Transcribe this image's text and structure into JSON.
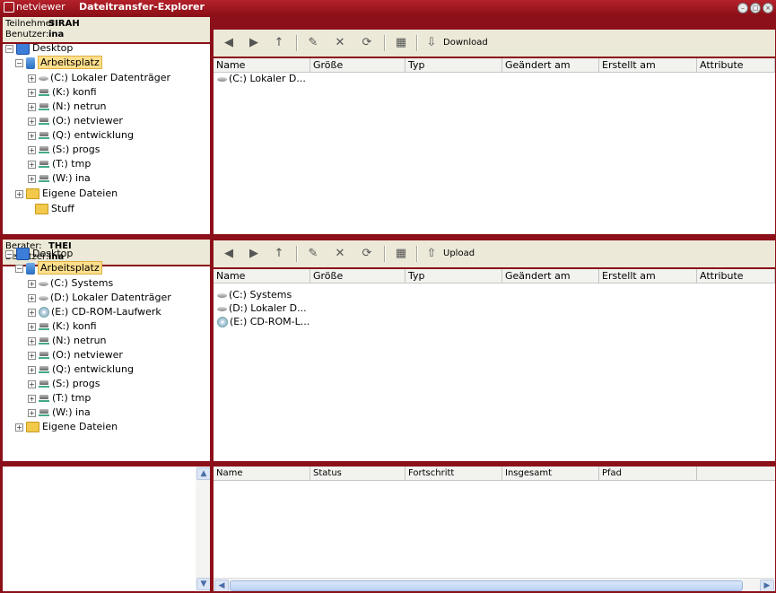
{
  "title_bar": {
    "app_name": "netviewer",
    "title": "Dateitransfer-Explorer"
  },
  "remote": {
    "info": {
      "label1": "Teilnehmer:",
      "value1": "SIRAH",
      "label2": "Benutzer:",
      "value2": "ina"
    },
    "toolbar": {
      "action_label": "Download"
    },
    "tree": {
      "root": "Desktop",
      "computer": "Arbeitsplatz",
      "drives": [
        "(C:) Lokaler Datenträger",
        "(K:) konfi",
        "(N:) netrun",
        "(O:) netviewer",
        "(Q:) entwicklung",
        "(S:) progs",
        "(T:) tmp",
        "(W:) ina"
      ],
      "my_files": "Eigene Dateien",
      "stuff": "Stuff"
    },
    "columns": [
      "Name",
      "Größe",
      "Typ",
      "Geändert am",
      "Erstellt am",
      "Attribute"
    ],
    "files": [
      "(C:) Lokaler D..."
    ]
  },
  "local": {
    "info": {
      "label1": "Berater:",
      "value1": "THEI",
      "label2": "Benutzer:",
      "value2": "ina"
    },
    "toolbar": {
      "action_label": "Upload"
    },
    "tree": {
      "root": "Desktop",
      "computer": "Arbeitsplatz",
      "drives": [
        "(C:) Systems",
        "(D:) Lokaler Datenträger",
        "(E:) CD-ROM-Laufwerk",
        "(K:) konfi",
        "(N:) netrun",
        "(O:) netviewer",
        "(Q:) entwicklung",
        "(S:) progs",
        "(T:) tmp",
        "(W:) ina"
      ],
      "my_files": "Eigene Dateien"
    },
    "columns": [
      "Name",
      "Größe",
      "Typ",
      "Geändert am",
      "Erstellt am",
      "Attribute"
    ],
    "files": [
      "(C:) Systems",
      "(D:) Lokaler D...",
      "(E:) CD-ROM-L..."
    ]
  },
  "transfers": {
    "columns": [
      "Name",
      "Status",
      "Fortschritt",
      "Insgesamt",
      "Pfad"
    ]
  },
  "colors": {
    "frame": "#8c1019",
    "title_bar": "#a91a22",
    "toolbar": "#ece9d8"
  }
}
